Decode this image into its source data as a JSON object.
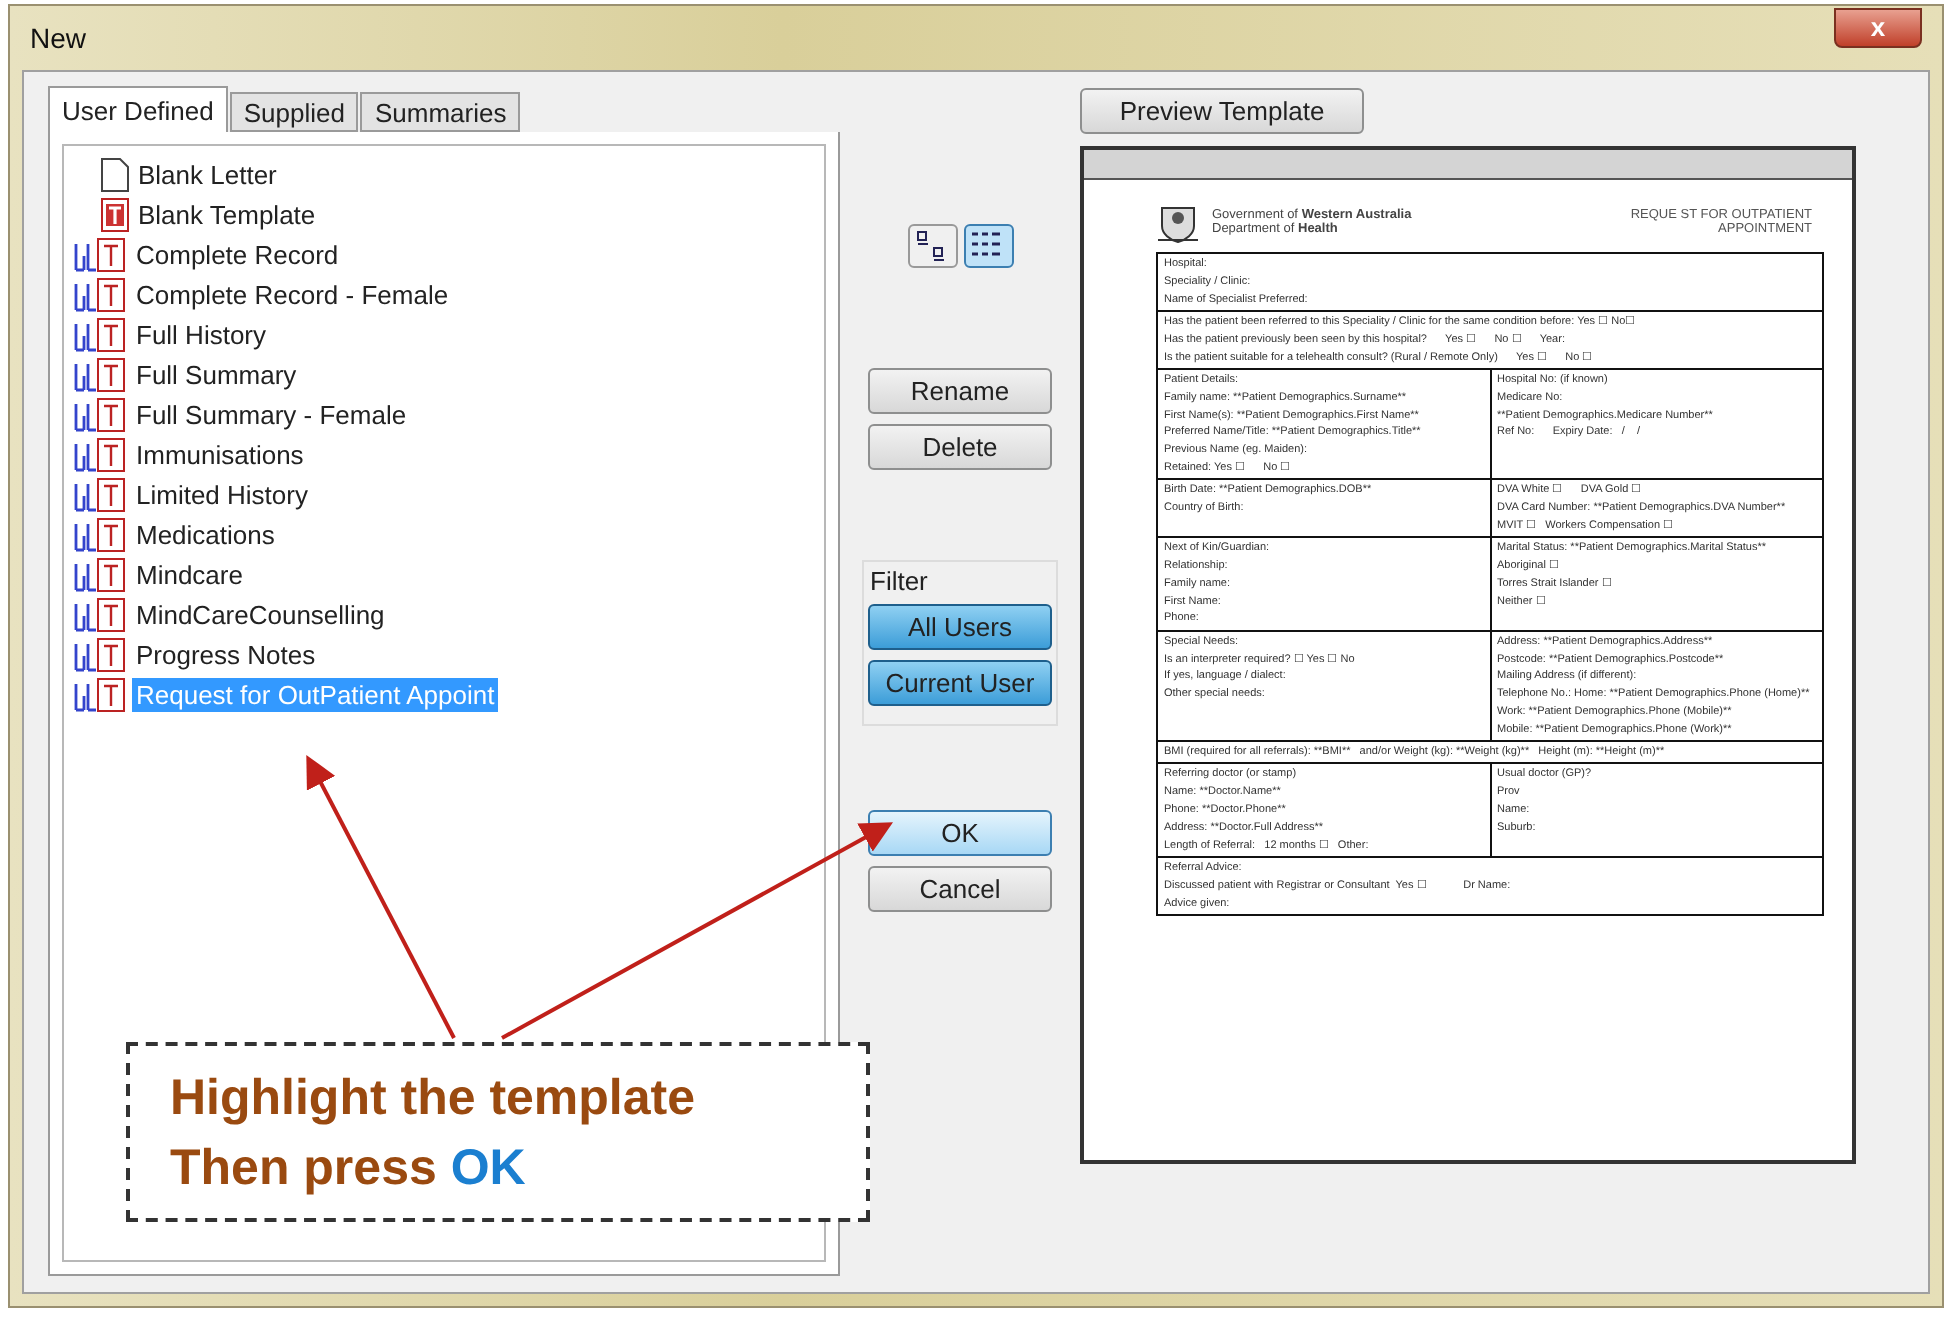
{
  "window": {
    "title": "New",
    "close": "x"
  },
  "tabs": [
    {
      "label": "User Defined",
      "selected": true
    },
    {
      "label": "Supplied",
      "selected": false
    },
    {
      "label": "Summaries",
      "selected": false
    }
  ],
  "templates": [
    {
      "label": "Blank Letter",
      "kind": "blank",
      "selected": false
    },
    {
      "label": "Blank Template",
      "kind": "template",
      "selected": false
    },
    {
      "label": "Complete Record",
      "kind": "shared",
      "selected": false
    },
    {
      "label": "Complete Record - Female",
      "kind": "shared",
      "selected": false
    },
    {
      "label": "Full History",
      "kind": "shared",
      "selected": false
    },
    {
      "label": "Full Summary",
      "kind": "shared",
      "selected": false
    },
    {
      "label": "Full Summary - Female",
      "kind": "shared",
      "selected": false
    },
    {
      "label": "Immunisations",
      "kind": "shared",
      "selected": false
    },
    {
      "label": "Limited History",
      "kind": "shared",
      "selected": false
    },
    {
      "label": "Medications",
      "kind": "shared",
      "selected": false
    },
    {
      "label": "Mindcare",
      "kind": "shared",
      "selected": false
    },
    {
      "label": "MindCareCounselling",
      "kind": "shared",
      "selected": false
    },
    {
      "label": "Progress Notes",
      "kind": "shared",
      "selected": false
    },
    {
      "label": "Request for OutPatient Appoint",
      "kind": "shared",
      "selected": true
    }
  ],
  "view_buttons": [
    {
      "kind": "icons",
      "selected": false
    },
    {
      "kind": "list",
      "selected": true
    }
  ],
  "actions": [
    "Rename",
    "Delete"
  ],
  "filter": {
    "title": "Filter",
    "options": [
      {
        "label": "All Users",
        "selected": true
      },
      {
        "label": "Current User",
        "selected": true
      }
    ]
  },
  "dialog_buttons": [
    {
      "label": "OK",
      "default": true
    },
    {
      "label": "Cancel",
      "default": false
    }
  ],
  "preview": {
    "button": "Preview Template",
    "document": {
      "org": "Government of **Western Australia**",
      "dept": "Department of **Health**",
      "title_lines": [
        "REQUE ST FOR OUTPATIENT",
        "APPOINTMENT"
      ],
      "sections": [
        {
          "left": [
            "Hospital:",
            "Speciality / Clinic:",
            "Name of Specialist Preferred:"
          ]
        },
        {
          "left": [
            "Has the patient been referred to this Speciality / Clinic for the same condition before: Yes ☐ No☐",
            "Has the patient previously been seen by this hospital?      Yes ☐      No ☐      Year:",
            "Is the patient suitable for a telehealth consult? (Rural / Remote Only)      Yes ☐      No ☐"
          ]
        },
        {
          "left": [
            "Patient Details:",
            "Family name: **Patient Demographics.Surname**",
            "First Name(s): **Patient Demographics.First Name**",
            "Preferred Name/Title: **Patient Demographics.Title**",
            "Previous Name (eg. Maiden):",
            "Retained: Yes ☐      No ☐"
          ],
          "right": [
            "Hospital No: (if known)",
            "Medicare No:",
            "**Patient Demographics.Medicare Number**",
            "Ref No:      Expiry Date:   /    /"
          ]
        },
        {
          "left": [
            "Birth Date: **Patient Demographics.DOB**",
            "Country of Birth:"
          ],
          "right": [
            "DVA White ☐      DVA Gold ☐",
            "DVA Card Number: **Patient Demographics.DVA Number**",
            "MVIT ☐   Workers Compensation ☐"
          ]
        },
        {
          "left": [
            "Next of Kin/Guardian:",
            "Relationship:",
            "Family name:",
            "First Name:",
            "Phone:"
          ],
          "right": [
            "Marital Status: **Patient Demographics.Marital Status**",
            "Aboriginal ☐",
            "Torres Strait Islander ☐",
            "Neither ☐"
          ]
        },
        {
          "left": [
            "Special Needs:",
            "Is an interpreter required? ☐ Yes ☐ No",
            "If yes, language / dialect:",
            "Other special needs:"
          ],
          "right": [
            "Address: **Patient Demographics.Address**",
            "Postcode: **Patient Demographics.Postcode**",
            "Mailing Address (if different):",
            "Telephone No.: Home: **Patient Demographics.Phone (Home)**",
            "Work: **Patient Demographics.Phone (Mobile)**",
            "Mobile: **Patient Demographics.Phone (Work)**"
          ]
        },
        {
          "left": [
            "BMI (required for all referrals): **BMI**   and/or Weight (kg): **Weight (kg)**   Height (m): **Height (m)**"
          ]
        },
        {
          "left": [
            "Referring doctor (or stamp)",
            "Name: **Doctor.Name**",
            "Phone: **Doctor.Phone**",
            "Address: **Doctor.Full Address**",
            "Length of Referral:   12 months ☐   Other:"
          ],
          "right": [
            "Usual doctor (GP)?",
            "Prov",
            "Name:",
            "Suburb:"
          ]
        },
        {
          "left": [
            "Referral Advice:",
            "Discussed patient with Registrar or Consultant  Yes ☐            Dr Name:",
            "Advice given:"
          ]
        }
      ]
    }
  },
  "callout": {
    "lines": [
      "Highlight the template",
      "Then press **OK**"
    ]
  }
}
